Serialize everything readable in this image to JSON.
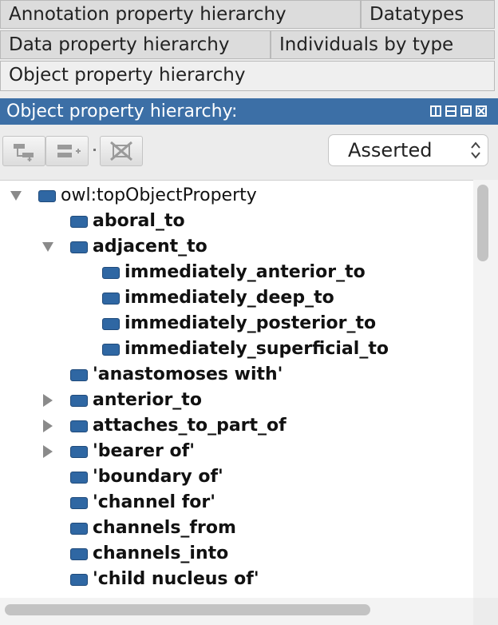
{
  "tabs": {
    "row1": [
      {
        "label": "Annotation property hierarchy"
      },
      {
        "label": "Datatypes"
      }
    ],
    "row2": [
      {
        "label": "Data property hierarchy"
      },
      {
        "label": "Individuals by type"
      }
    ],
    "row3": [
      {
        "label": "Object property hierarchy"
      }
    ]
  },
  "panel": {
    "title": "Object property hierarchy:"
  },
  "toolbar": {
    "view_select_value": "Asserted"
  },
  "tree": {
    "root": "owl:topObjectProperty",
    "items": [
      {
        "label": "aboral_to"
      },
      {
        "label": "adjacent_to"
      },
      {
        "label": "immediately_anterior_to"
      },
      {
        "label": "immediately_deep_to"
      },
      {
        "label": "immediately_posterior_to"
      },
      {
        "label": "immediately_superficial_to"
      },
      {
        "label": "'anastomoses with'"
      },
      {
        "label": "anterior_to"
      },
      {
        "label": "attaches_to_part_of"
      },
      {
        "label": "'bearer of'"
      },
      {
        "label": "'boundary of'"
      },
      {
        "label": "'channel for'"
      },
      {
        "label": "channels_from"
      },
      {
        "label": "channels_into"
      },
      {
        "label": "'child nucleus of'"
      }
    ]
  },
  "colors": {
    "titlebar": "#3c6fa6",
    "property_icon": "#2f67a3"
  }
}
